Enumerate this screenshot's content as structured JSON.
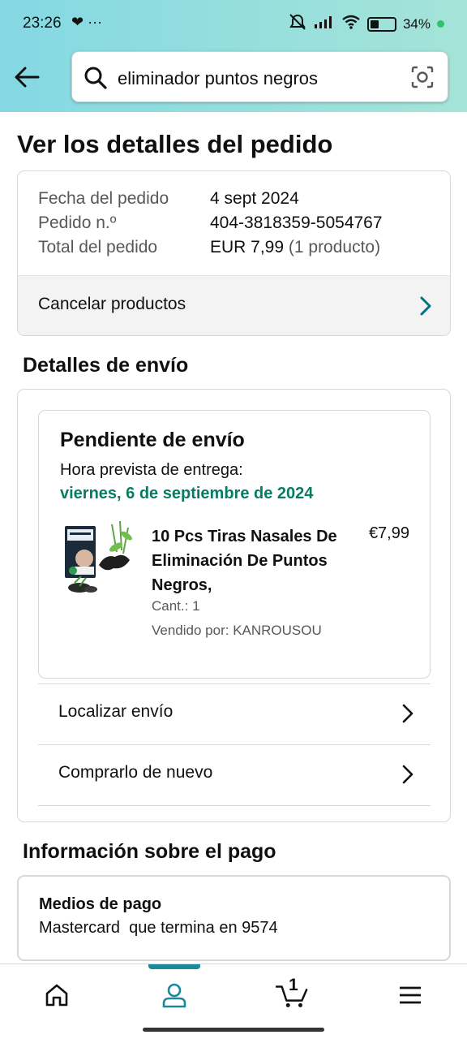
{
  "status_bar": {
    "time": "23:26",
    "left_icons": "❤ ···",
    "battery_percent": 34,
    "battery_text": "34%"
  },
  "search": {
    "query": "eliminador puntos negros"
  },
  "page": {
    "title": "Ver los detalles del pedido"
  },
  "order_summary": {
    "rows": [
      {
        "label": "Fecha del pedido",
        "value": "4 sept 2024",
        "extra": ""
      },
      {
        "label": "Pedido n.º",
        "value": "404-3818359-5054767",
        "extra": ""
      },
      {
        "label": "Total del pedido",
        "value": "EUR 7,99",
        "extra": " (1 producto)"
      }
    ],
    "cancel_label": "Cancelar productos"
  },
  "shipping": {
    "section_title": "Detalles de envío",
    "status": "Pendiente de envío",
    "eta_label": "Hora prevista de entrega:",
    "eta_date": "viernes, 6 de septiembre de 2024",
    "product": {
      "title": "10 Pcs Tiras Nasales De Eliminación De Puntos Negros,",
      "price": "€7,99",
      "qty": "Cant.: 1",
      "seller": "Vendido por: KANROUSOU"
    },
    "actions": [
      {
        "label": "Localizar envío"
      },
      {
        "label": "Comprarlo de nuevo"
      }
    ]
  },
  "payment": {
    "section_title": "Información sobre el pago",
    "methods_title": "Medios de pago",
    "method_value": "Mastercard  que termina en 9574"
  },
  "bottom_nav": {
    "items": [
      "home-icon",
      "account-icon",
      "cart-icon",
      "menu-icon"
    ],
    "active_item": "account-icon",
    "cart_count": "1",
    "accent_color": "#1a8a9a"
  },
  "colors": {
    "header_gradient_start": "#84d8e3",
    "header_gradient_end": "#a5e4d8",
    "delivery_green": "#067d62",
    "chevron_teal": "#007185"
  }
}
